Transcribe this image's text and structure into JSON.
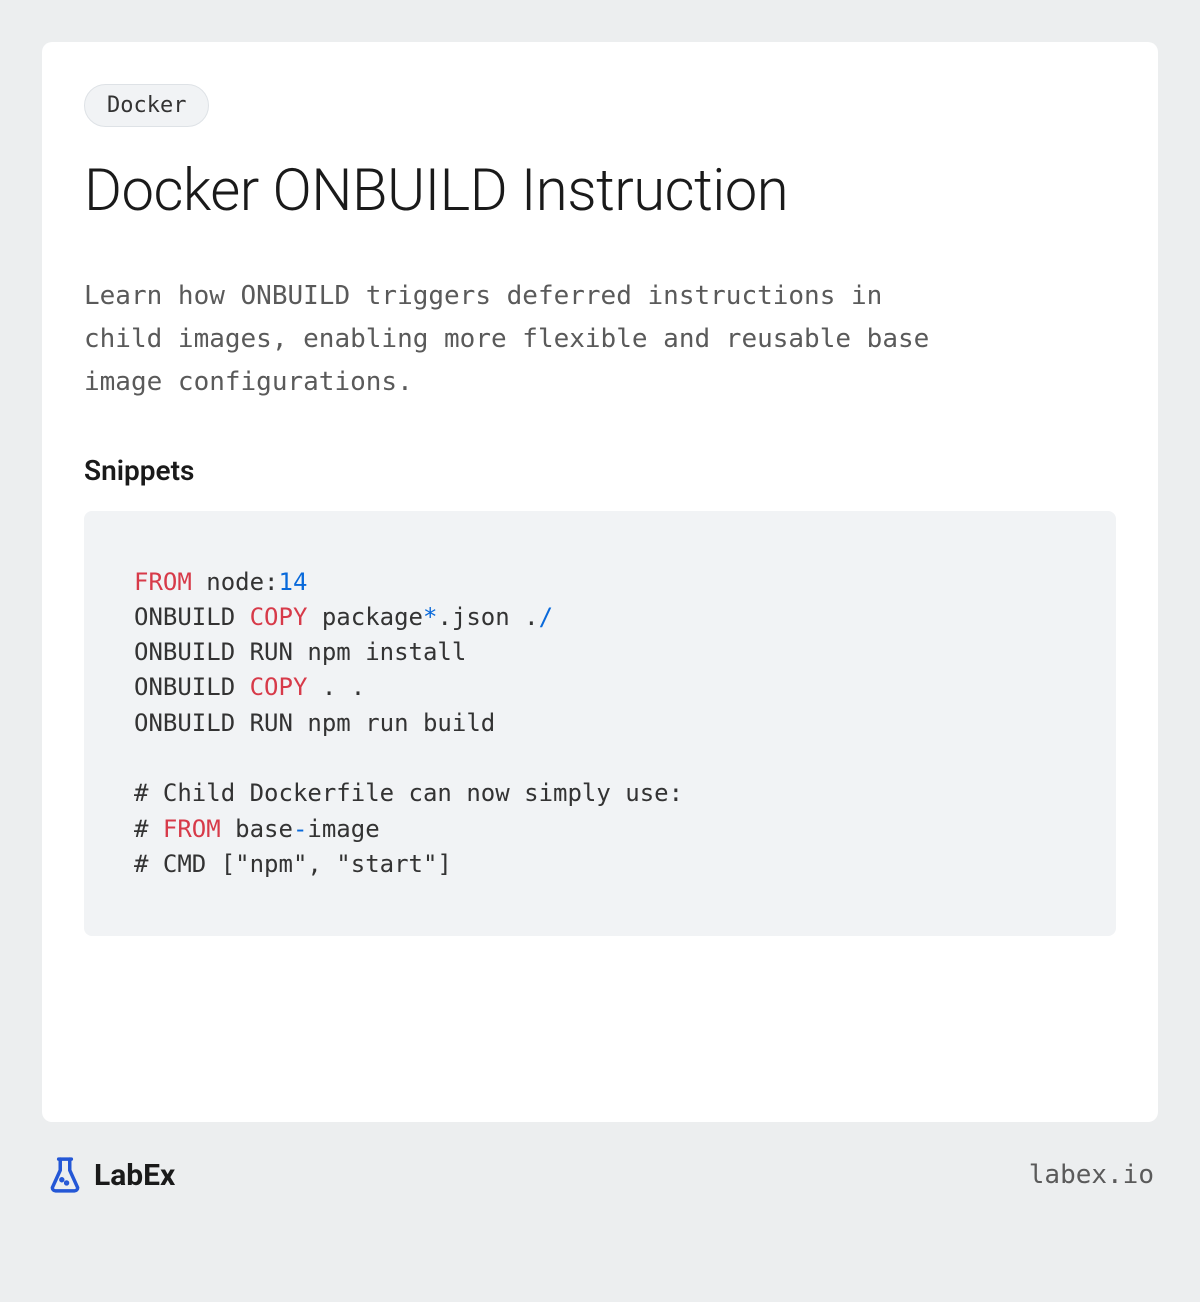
{
  "badge": "Docker",
  "title": "Docker ONBUILD Instruction",
  "description": "Learn how ONBUILD triggers deferred instructions in child images, enabling more flexible and reusable base image configurations.",
  "snippets_heading": "Snippets",
  "code": {
    "l1": {
      "a": "FROM",
      "b": " node:",
      "c": "14"
    },
    "l2": {
      "a": "ONBUILD ",
      "b": "COPY",
      "c": " package",
      "d": "*",
      "e": ".json .",
      "f": "/"
    },
    "l3": "ONBUILD RUN npm install",
    "l4": {
      "a": "ONBUILD ",
      "b": "COPY",
      "c": " . ."
    },
    "l5": "ONBUILD RUN npm run build",
    "l6": "",
    "l7": "# Child Dockerfile can now simply use:",
    "l8": {
      "a": "# ",
      "b": "FROM",
      "c": " base",
      "d": "-",
      "e": "image"
    },
    "l9": "# CMD [\"npm\", \"start\"]"
  },
  "footer": {
    "brand": "LabEx",
    "url": "labex.io"
  }
}
